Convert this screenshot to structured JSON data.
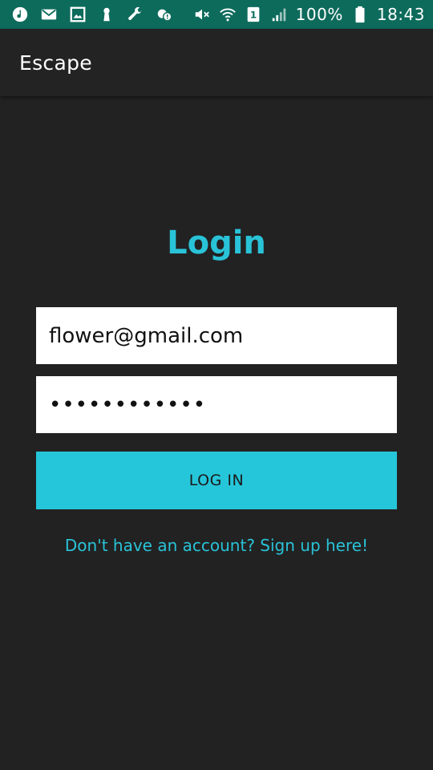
{
  "status_bar": {
    "icons_left": [
      "music-icon",
      "mail-icon",
      "image-icon",
      "keyhole-icon",
      "wrench-icon",
      "cloud-alert-icon"
    ],
    "icons_right": [
      "mute-icon",
      "wifi-icon",
      "sim-icon",
      "signal-icon",
      "battery-icon"
    ],
    "sim_number": "1",
    "battery_text": "100%",
    "time": "18:43",
    "color": "#0d6b5c"
  },
  "app_bar": {
    "title": "Escape"
  },
  "login": {
    "title": "Login",
    "email_value": "flower@gmail.com",
    "password_value": "••••••••••••",
    "button_label": "LOG IN",
    "signup_text": "Don't have an account? Sign up here!"
  },
  "colors": {
    "background": "#222222",
    "accent": "#26c6da",
    "field_background": "#ffffff"
  }
}
